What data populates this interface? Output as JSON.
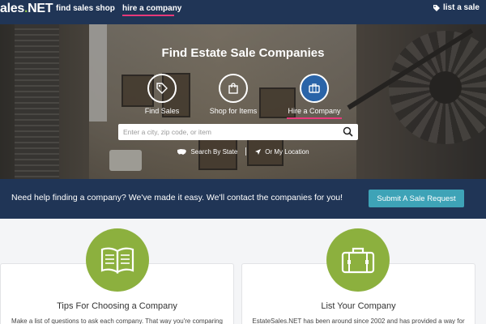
{
  "nav": {
    "logo_prefix": "ales",
    "logo_dot": ".",
    "logo_suffix": "NET",
    "links": [
      "find sales",
      "shop",
      "hire a company"
    ],
    "list_sale": "list a sale"
  },
  "hero": {
    "title": "Find Estate Sale Companies",
    "categories": [
      {
        "label": "Find Sales",
        "icon": "tag-icon"
      },
      {
        "label": "Shop for Items",
        "icon": "shopping-bag-icon"
      },
      {
        "label": "Hire a Company",
        "icon": "briefcase-icon",
        "active": true
      }
    ],
    "search_placeholder": "Enter a city, zip code, or item",
    "search_by_state": "Search By State",
    "my_location": "Or My Location"
  },
  "banner": {
    "text": "Need help finding a company? We've made it easy. We'll contact the companies for you!",
    "button": "Submit A Sale Request"
  },
  "cards": [
    {
      "title": "Tips For Choosing a Company",
      "text": "Make a list of questions to ask each company. That way you're comparing",
      "icon": "open-book-icon"
    },
    {
      "title": "List Your Company",
      "text": "EstateSales.NET has been around since 2002 and has provided a way for",
      "icon": "suitcase-icon"
    }
  ],
  "colors": {
    "nav": "#203556",
    "accent": "#e8397a",
    "active_cat": "#2a64a8",
    "button": "#3ea3b7",
    "green": "#8cb03e"
  }
}
